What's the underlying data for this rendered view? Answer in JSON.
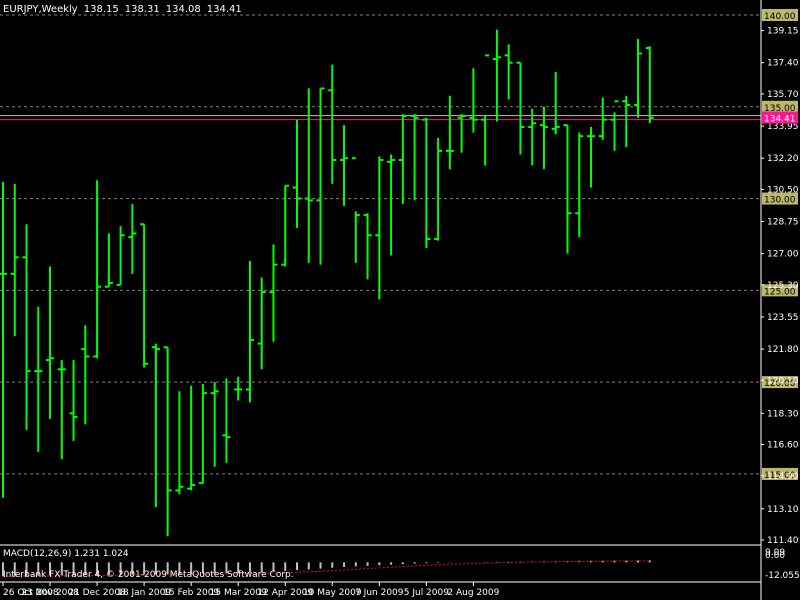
{
  "header": {
    "symbol": "EURJPY,Weekly",
    "open": "138.15",
    "high": "138.31",
    "low": "134.08",
    "close": "134.41"
  },
  "macd": {
    "label": "MACD(12,26,9) 1.231 1.024",
    "axis_top": "9.09",
    "axis_zero": "0.00",
    "axis_bottom": "-12.055"
  },
  "copyright": "Interbank FX Trader 4, © 2001-2009 MetaQuotes Software Corp.",
  "colors": {
    "background": "#000000",
    "bars": "#00ff00",
    "grid": "#808080",
    "axis_text": "#ffffff",
    "level_tag": "#bdb76b",
    "price_line": "#ff1493",
    "signal_line": "#ff0000"
  },
  "chart_data": {
    "type": "ohlc",
    "timeframe": "Weekly",
    "symbol": "EURJPY",
    "ylim": [
      111.4,
      140.0
    ],
    "y_tick_labels": [
      "139.15",
      "137.40",
      "135.70",
      "133.95",
      "132.20",
      "130.50",
      "128.75",
      "127.00",
      "125.30",
      "123.55",
      "121.80",
      "120.10",
      "118.30",
      "116.60",
      "114.90",
      "113.10",
      "111.40"
    ],
    "horizontal_levels": [
      {
        "value": 140.0,
        "label": "140.00"
      },
      {
        "value": 135.0,
        "label": "135.00"
      },
      {
        "value": 130.0,
        "label": "130.00"
      },
      {
        "value": 125.0,
        "label": "125.00"
      },
      {
        "value": 120.0,
        "label": "120.00"
      },
      {
        "value": 115.0,
        "label": "115.00"
      }
    ],
    "current_price": {
      "value": 134.41,
      "label": "134.41"
    },
    "x_labels": [
      "26 Oct 2008",
      "23 Nov 2008",
      "21 Dec 2008",
      "18 Jan 2009",
      "15 Feb 2009",
      "15 Mar 2009",
      "12 Apr 2009",
      "10 May 2009",
      "7 Jun 2009",
      "5 Jul 2009",
      "2 Aug 2009"
    ],
    "bars": [
      {
        "o": 125.9,
        "h": 130.9,
        "l": 113.7,
        "c": 125.9
      },
      {
        "o": 125.9,
        "h": 130.8,
        "l": 122.5,
        "c": 126.8
      },
      {
        "o": 126.8,
        "h": 128.6,
        "l": 117.4,
        "c": 120.6
      },
      {
        "o": 120.6,
        "h": 124.1,
        "l": 116.2,
        "c": 120.6
      },
      {
        "o": 121.2,
        "h": 126.3,
        "l": 118.0,
        "c": 121.3
      },
      {
        "o": 120.7,
        "h": 121.2,
        "l": 115.8,
        "c": 120.7
      },
      {
        "o": 118.3,
        "h": 121.2,
        "l": 116.8,
        "c": 118.1
      },
      {
        "o": 121.8,
        "h": 123.1,
        "l": 117.7,
        "c": 121.4
      },
      {
        "o": 121.4,
        "h": 131.0,
        "l": 121.3,
        "c": 125.2
      },
      {
        "o": 125.2,
        "h": 128.1,
        "l": 125.2,
        "c": 125.4
      },
      {
        "o": 125.3,
        "h": 128.5,
        "l": 125.3,
        "c": 128.0
      },
      {
        "o": 127.9,
        "h": 129.7,
        "l": 125.9,
        "c": 128.1
      },
      {
        "o": 128.6,
        "h": 128.6,
        "l": 120.8,
        "c": 121.0
      },
      {
        "o": 121.9,
        "h": 122.1,
        "l": 113.2,
        "c": 121.8
      },
      {
        "o": 121.9,
        "h": 121.9,
        "l": 111.6,
        "c": 114.1
      },
      {
        "o": 114.1,
        "h": 119.5,
        "l": 113.9,
        "c": 114.3
      },
      {
        "o": 114.2,
        "h": 119.8,
        "l": 114.1,
        "c": 114.4
      },
      {
        "o": 114.5,
        "h": 119.9,
        "l": 114.5,
        "c": 119.4
      },
      {
        "o": 119.4,
        "h": 120.0,
        "l": 115.4,
        "c": 119.5
      },
      {
        "o": 117.1,
        "h": 120.2,
        "l": 115.6,
        "c": 117.0
      },
      {
        "o": 119.6,
        "h": 120.3,
        "l": 119.0,
        "c": 119.6
      },
      {
        "o": 119.6,
        "h": 126.6,
        "l": 118.9,
        "c": 122.3
      },
      {
        "o": 122.1,
        "h": 125.7,
        "l": 120.7,
        "c": 124.9
      },
      {
        "o": 124.9,
        "h": 127.5,
        "l": 122.2,
        "c": 126.4
      },
      {
        "o": 126.4,
        "h": 130.7,
        "l": 126.3,
        "c": 130.7
      },
      {
        "o": 130.6,
        "h": 134.3,
        "l": 128.4,
        "c": 130.0
      },
      {
        "o": 130.0,
        "h": 136.0,
        "l": 126.5,
        "c": 129.9
      },
      {
        "o": 129.9,
        "h": 136.0,
        "l": 126.4,
        "c": 136.0
      },
      {
        "o": 135.9,
        "h": 137.3,
        "l": 130.8,
        "c": 132.1
      },
      {
        "o": 132.1,
        "h": 134.0,
        "l": 129.6,
        "c": 132.2
      },
      {
        "o": 132.2,
        "h": 129.3,
        "l": 126.5,
        "c": 129.1
      },
      {
        "o": 129.1,
        "h": 129.2,
        "l": 125.6,
        "c": 128.0
      },
      {
        "o": 128.0,
        "h": 132.3,
        "l": 124.5,
        "c": 132.1
      },
      {
        "o": 132.0,
        "h": 132.4,
        "l": 126.9,
        "c": 132.1
      },
      {
        "o": 132.1,
        "h": 134.6,
        "l": 129.7,
        "c": 134.5
      },
      {
        "o": 134.5,
        "h": 134.6,
        "l": 129.9,
        "c": 134.4
      },
      {
        "o": 134.3,
        "h": 134.4,
        "l": 127.3,
        "c": 127.8
      },
      {
        "o": 127.8,
        "h": 133.3,
        "l": 127.7,
        "c": 132.6
      },
      {
        "o": 132.6,
        "h": 135.6,
        "l": 131.6,
        "c": 132.6
      },
      {
        "o": 134.4,
        "h": 134.6,
        "l": 132.5,
        "c": 134.5
      },
      {
        "o": 134.4,
        "h": 137.1,
        "l": 133.6,
        "c": 134.3
      },
      {
        "o": 134.3,
        "h": 134.5,
        "l": 131.8,
        "c": 137.8
      },
      {
        "o": 137.6,
        "h": 139.2,
        "l": 134.2,
        "c": 137.7
      },
      {
        "o": 137.8,
        "h": 138.4,
        "l": 135.4,
        "c": 137.4
      },
      {
        "o": 137.4,
        "h": 137.4,
        "l": 132.4,
        "c": 133.9
      },
      {
        "o": 133.9,
        "h": 134.9,
        "l": 131.8,
        "c": 134.1
      },
      {
        "o": 134.0,
        "h": 135.0,
        "l": 131.6,
        "c": 133.9
      },
      {
        "o": 133.8,
        "h": 136.9,
        "l": 133.5,
        "c": 133.9
      },
      {
        "o": 134.0,
        "h": 134.0,
        "l": 127.0,
        "c": 129.2
      },
      {
        "o": 129.2,
        "h": 133.6,
        "l": 127.9,
        "c": 133.4
      },
      {
        "o": 133.4,
        "h": 133.9,
        "l": 130.6,
        "c": 133.4
      },
      {
        "o": 133.4,
        "h": 135.5,
        "l": 133.2,
        "c": 134.3
      },
      {
        "o": 134.3,
        "h": 134.7,
        "l": 132.6,
        "c": 135.3
      },
      {
        "o": 135.3,
        "h": 135.6,
        "l": 132.8,
        "c": 135.1
      },
      {
        "o": 135.1,
        "h": 138.7,
        "l": 134.4,
        "c": 137.9
      },
      {
        "o": 138.2,
        "h": 138.3,
        "l": 134.1,
        "c": 134.4
      }
    ],
    "macd_histogram": [
      -9.5,
      -9.3,
      -9.2,
      -9.1,
      -9.0,
      -8.9,
      -8.8,
      -8.7,
      -8.6,
      -8.5,
      -8.4,
      -8.3,
      -8.2,
      -8.1,
      -8.0,
      -7.9,
      -7.8,
      -7.7,
      -7.6,
      -7.5,
      -7.3,
      -7.0,
      -6.7,
      -6.3,
      -5.8,
      -5.3,
      -4.8,
      -4.3,
      -3.7,
      -3.2,
      -2.8,
      -2.4,
      -2.0,
      -1.6,
      -1.2,
      -0.9,
      -0.6,
      -0.4,
      -0.2,
      0.0,
      0.1,
      0.2,
      0.3,
      0.4,
      0.5,
      0.6,
      0.7,
      0.8,
      0.9,
      1.0,
      1.0,
      1.1,
      1.1,
      1.2,
      1.2,
      1.231
    ]
  }
}
